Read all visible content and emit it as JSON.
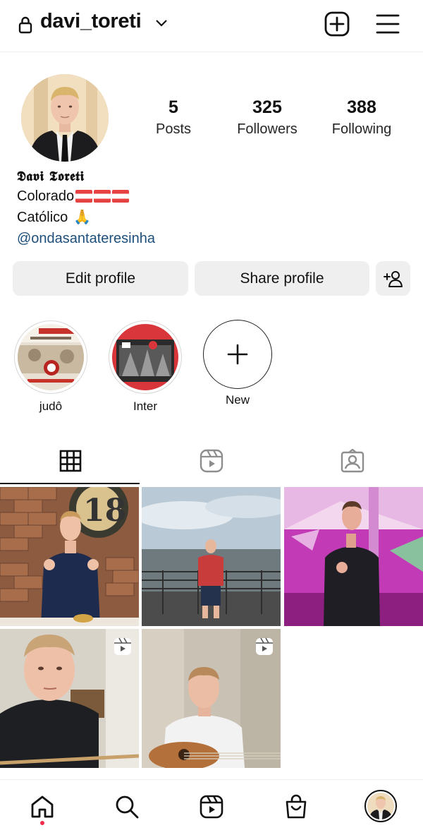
{
  "header": {
    "username": "davi_toreti",
    "icons": [
      "lock-icon",
      "chevron-down-icon",
      "new-post-icon",
      "menu-icon"
    ]
  },
  "profile": {
    "stats": [
      {
        "value": "5",
        "label": "Posts"
      },
      {
        "value": "325",
        "label": "Followers"
      },
      {
        "value": "388",
        "label": "Following"
      }
    ],
    "display_name": "𝕯𝖆𝖛𝖎 𝕿𝖔𝖗𝖊𝖙𝖎",
    "bio_line1": "Colorado",
    "bio_line1_emoji": "flag-icons x3",
    "bio_line2": "Católico",
    "bio_line2_emoji": "🙏",
    "bio_link": "@ondasantateresinha"
  },
  "buttons": {
    "edit": "Edit profile",
    "share": "Share profile"
  },
  "highlights": [
    {
      "label": "judô"
    },
    {
      "label": "Inter"
    },
    {
      "label": "New"
    }
  ],
  "tabs": [
    "grid-icon",
    "reels-icon",
    "tagged-icon"
  ],
  "posts": [
    {
      "type": "photo"
    },
    {
      "type": "photo"
    },
    {
      "type": "photo"
    },
    {
      "type": "reel"
    },
    {
      "type": "reel"
    }
  ],
  "bottom_nav": [
    "home-icon",
    "search-icon",
    "reels-icon",
    "shop-icon",
    "profile-avatar"
  ],
  "colors": {
    "button_bg": "#efefef",
    "link": "#1e4f7a",
    "notification_dot": "#ed2d4b"
  }
}
